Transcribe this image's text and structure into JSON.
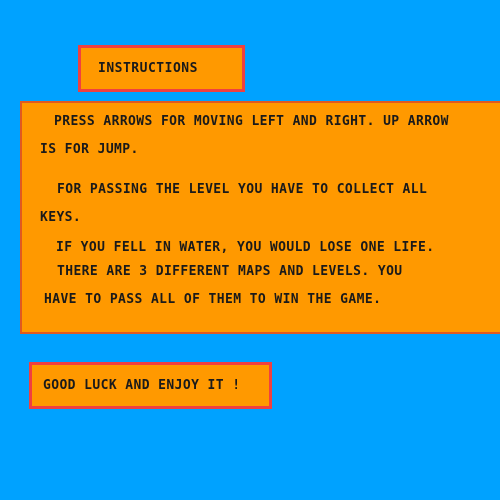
{
  "colors": {
    "background": "#00a2ff",
    "panel": "#ff9900",
    "border": "#f04040",
    "text": "#1a1a1a"
  },
  "title": "INSTRUCTIONS",
  "instructions": {
    "lines": [
      "PRESS ARROWS FOR MOVING LEFT AND RIGHT. UP ARROW",
      "IS FOR JUMP.",
      "FOR PASSING THE LEVEL YOU HAVE TO COLLECT ALL",
      "KEYS.",
      "IF YOU FELL IN WATER, YOU WOULD LOSE ONE LIFE.",
      "THERE ARE 3 DIFFERENT MAPS AND LEVELS. YOU",
      "HAVE TO PASS ALL OF THEM TO WIN THE GAME."
    ]
  },
  "footer": "GOOD LUCK AND ENJOY IT !"
}
